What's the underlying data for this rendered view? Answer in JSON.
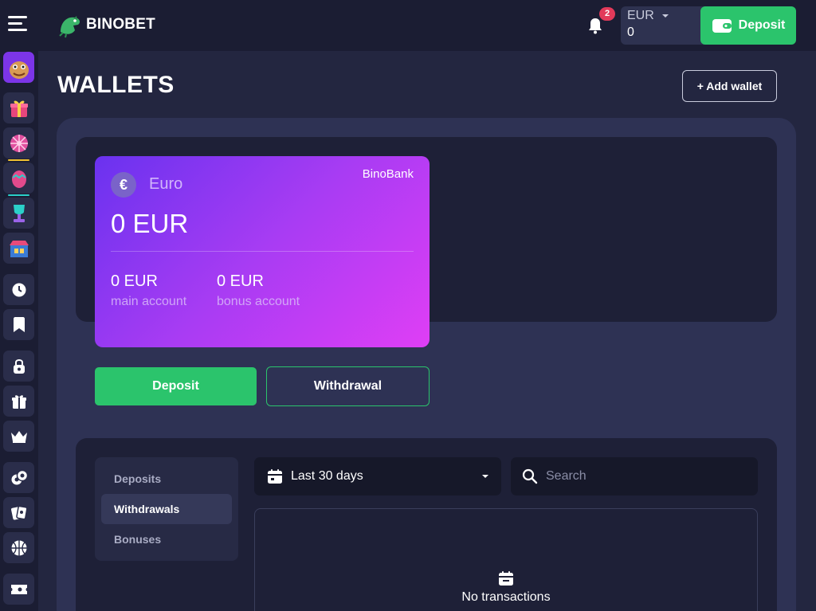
{
  "header": {
    "brand": "BINOBET",
    "notifications_count": "2",
    "currency_code": "EUR",
    "balance": "0",
    "deposit_label": "Deposit"
  },
  "sidebar": {
    "items": [
      {
        "name": "dino-avatar",
        "icon": "dino-avatar"
      },
      {
        "name": "gift-box",
        "icon": "gift-box-icon"
      },
      {
        "name": "wheel",
        "icon": "wheel-icon",
        "accent": "#f1c232"
      },
      {
        "name": "egg",
        "icon": "egg-icon",
        "accent": "#2bd0c9"
      },
      {
        "name": "trophy",
        "icon": "trophy-icon"
      },
      {
        "name": "shop",
        "icon": "shop-icon"
      },
      {
        "name": "recent",
        "icon": "clock-icon"
      },
      {
        "name": "favorites",
        "icon": "bookmark-icon"
      },
      {
        "name": "account",
        "icon": "lock-icon"
      },
      {
        "name": "bonuses",
        "icon": "gift-icon"
      },
      {
        "name": "vip",
        "icon": "crown-icon"
      },
      {
        "name": "casino",
        "icon": "chips-icon"
      },
      {
        "name": "cards",
        "icon": "cards-icon"
      },
      {
        "name": "sports",
        "icon": "basketball-icon"
      },
      {
        "name": "tickets",
        "icon": "ticket-icon"
      }
    ]
  },
  "page": {
    "title": "WALLETS",
    "add_wallet_label": "+ Add wallet"
  },
  "wallet": {
    "currency_symbol": "€",
    "name": "Euro",
    "bank": "BinoBank",
    "total": "0 EUR",
    "main_value": "0 EUR",
    "main_label": "main account",
    "bonus_value": "0 EUR",
    "bonus_label": "bonus account",
    "deposit_label": "Deposit",
    "withdraw_label": "Withdrawal"
  },
  "history": {
    "tabs": [
      {
        "label": "Deposits",
        "active": false
      },
      {
        "label": "Withdrawals",
        "active": true
      },
      {
        "label": "Bonuses",
        "active": false
      }
    ],
    "date_range": "Last 30 days",
    "search_placeholder": "Search",
    "empty_text": "No transactions"
  },
  "colors": {
    "background": "#232640",
    "topbar": "#1b1d33",
    "accent_green": "#2bc46c",
    "badge_red": "#e23a5a",
    "card_gradient_start": "#6a32ef",
    "card_gradient_end": "#df3ef5"
  }
}
